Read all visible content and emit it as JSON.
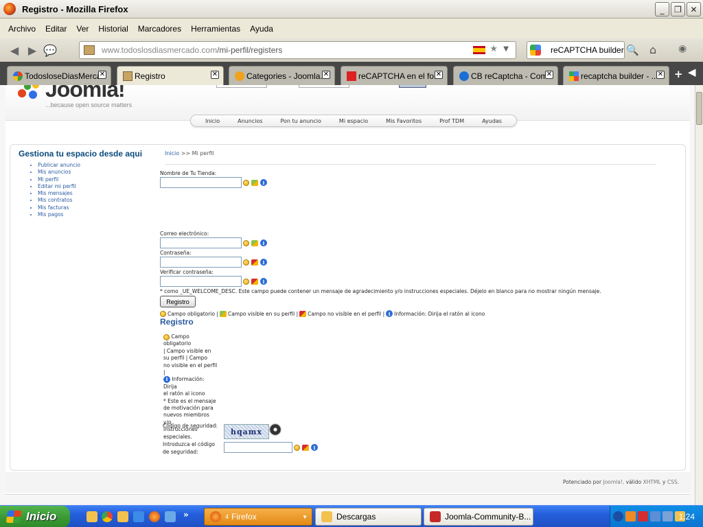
{
  "window": {
    "title": "Registro - Mozilla Firefox"
  },
  "menu": [
    "Archivo",
    "Editar",
    "Ver",
    "Historial",
    "Marcadores",
    "Herramientas",
    "Ayuda"
  ],
  "nav": {
    "url_domain": "www.todoslosdiasmercado.com",
    "url_path": "/mi-perfil/registers",
    "search_query": "reCAPTCHA builder"
  },
  "tabs": [
    {
      "label": "TodosloseDiasMercad...",
      "active": false
    },
    {
      "label": "Registro",
      "active": true
    },
    {
      "label": "Categories - Joomla...",
      "active": false
    },
    {
      "label": "reCAPTCHA en el fo...",
      "active": false
    },
    {
      "label": "CB reCaptcha - Com...",
      "active": false
    },
    {
      "label": "recaptcha builder - ...",
      "active": false
    }
  ],
  "header": {
    "logo_text": "Joomla!",
    "tagline": "...because open source matters"
  },
  "topnav": [
    "Inicio",
    "Anuncios",
    "Pon tu anuncio",
    "Mi espacio",
    "Mis Favoritos",
    "Prof TDM",
    "Ayudas"
  ],
  "sidebar": {
    "title": "Gestiona tu espacio desde aqui",
    "items": [
      "Publicar anuncio",
      "Mis anuncios",
      "Mi perfil",
      "Editar mi perfil",
      "Mis mensajes",
      "Mis contratos",
      "Mis facturas",
      "Mis pagos"
    ]
  },
  "breadcrumb": {
    "home": "Inicio",
    "sep": ">>",
    "current": "Mi perfil"
  },
  "form": {
    "store_label": "Nombre de Tu Tienda:",
    "email_label": "Correo electrónico:",
    "password_label": "Contraseña:",
    "verify_label": "Verificar contraseña:",
    "welcome_note": "* como _UE_WELCOME_DESC. Este campo puede contener un mensaje de agradecimiento y/o instrucciones especiales. Déjelo en blanco para no mostrar ningún mensaje.",
    "submit_label": "Registro",
    "legend": {
      "required": "Campo obligatorio |",
      "visible": "Campo visible en su perfil |",
      "hidden": "Campo no visible en el perfil |",
      "info": "Información: Dirija el ratón al icono"
    }
  },
  "registro": {
    "title": "Registro",
    "legend_lines": [
      "Campo obligatorio",
      "| Campo visible en",
      "su perfil | Campo",
      "no visible en el perfil |",
      "Información: Dirija",
      "el ratón al icono",
      "* Este es el mensaje",
      "de motivación para",
      "nuevos miembros y/o",
      "instrucciones",
      "especiales."
    ],
    "captcha_label": "Código de seguridad:",
    "captcha_text": "hqamx",
    "captcha_input_label_1": "Introduzca el código",
    "captcha_input_label_2": "de seguridad:"
  },
  "footer": {
    "prefix": "Potenciado por",
    "link1": "Joomla!",
    "mid": ". válido",
    "link2": "XHTML",
    "and": "y",
    "link3": "CSS",
    "end": "."
  },
  "taskbar": {
    "start": "Inicio",
    "tasks": [
      {
        "label": "Firefox",
        "prefix": "4",
        "active": true
      },
      {
        "label": "Descargas",
        "active": false
      },
      {
        "label": "Joomla-Community-B...",
        "active": false
      }
    ],
    "clock": "1:24"
  }
}
